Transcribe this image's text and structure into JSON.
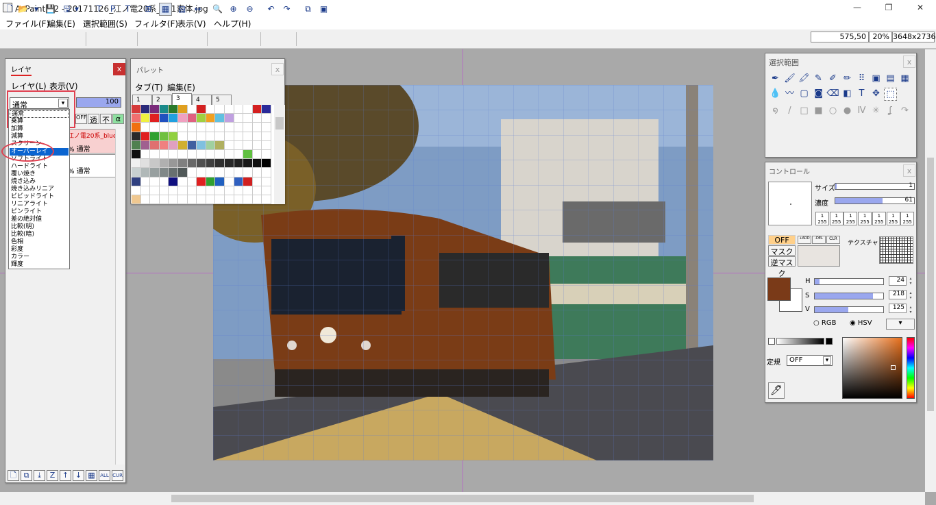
{
  "window": {
    "title": "AzPainter2 - 20171126_江ノ電20系_001素体.jpg",
    "minimize": "—",
    "maximize": "❐",
    "close": "✕"
  },
  "menu": [
    "ファイル(F)",
    "編集(E)",
    "選択範囲(S)",
    "フィルタ(F)",
    "表示(V)",
    "ヘルプ(H)"
  ],
  "status": {
    "coords": "575,50",
    "zoom": "20%",
    "size": "3648x2736"
  },
  "toolbar": {
    "icons": [
      "new-icon",
      "open-icon",
      "open-dropdown-icon",
      "save-icon",
      "save-as-icon",
      "save-dropdown-icon",
      "layer-panel-icon",
      "palette-panel-icon",
      "text-panel-icon",
      "grid-icon",
      "checker-icon",
      "grid2-icon",
      "fit-icon",
      "zoom-icon",
      "zoom-in-icon",
      "zoom-out-icon",
      "undo-icon",
      "redo-icon",
      "filter-icon",
      "select-icon"
    ],
    "glyphs": [
      "🗋",
      "📂",
      "▾",
      "💾",
      "🖫",
      "▾",
      "T",
      "P",
      "T",
      "⊞",
      "▦",
      "▤",
      "↔",
      "🔍",
      "⊕",
      "⊖",
      "↶",
      "↷",
      "⧉",
      "▣"
    ]
  },
  "layer_panel": {
    "title": "レイヤ",
    "close": "x",
    "menu": [
      "レイヤ(L)",
      "表示(V)"
    ],
    "blend_selected": "通常",
    "opacity": "100",
    "blend_options": [
      "通常",
      "乗算",
      "加算",
      "減算",
      "スクリーン",
      "オーバーレイ",
      "ソフトライト",
      "ハードライト",
      "覆い焼き",
      "焼き込み",
      "焼き込みリニア",
      "ビビッドライト",
      "リニアライト",
      "ピンライト",
      "差の絶対値",
      "比較(明)",
      "比較(暗)",
      "色相",
      "彩度",
      "カラー",
      "輝度"
    ],
    "selected_option": "オーバーレイ",
    "flags": [
      "OFF",
      "透",
      "不",
      "α"
    ],
    "layers": [
      {
        "name": "江ノ電20系_blue",
        "mode": "% 通常"
      },
      {
        "name": "",
        "mode": "% 通常"
      }
    ],
    "bottom_buttons": [
      "🗋",
      "⧉",
      "⤓",
      "Z",
      "↑",
      "↓",
      "▦",
      "ALL",
      "CUR"
    ]
  },
  "palette_panel": {
    "title": "パレット",
    "close": "x",
    "menu": [
      "タブ(T)",
      "編集(E)"
    ],
    "tabs": [
      "1",
      "2",
      "3",
      "4",
      "5"
    ],
    "active_tab": "3",
    "rows": [
      [
        "#d63b3b",
        "#2a2a7a",
        "#7a2a7a",
        "#1a8a8a",
        "#2a7a2a",
        "#e0a020",
        "",
        "#d42020",
        "",
        "",
        "",
        "",
        "",
        "#d42020",
        "#2a2a9a"
      ],
      [
        "#f07070",
        "#f0f040",
        "#e02020",
        "#2050c0",
        "#20a0e0",
        "#f0a0c0",
        "#e06080",
        "#a0d040",
        "#f0a020",
        "#60c0e0",
        "#c0a0e0",
        "",
        "",
        "",
        ""
      ],
      [
        "#f07010",
        "",
        "",
        "",
        "",
        "",
        "",
        "",
        "",
        "",
        "",
        "",
        "",
        "",
        ""
      ],
      [
        "#2a2a2a",
        "#e02020",
        "#30a030",
        "#70c040",
        "#90d040",
        "",
        "",
        "",
        "",
        "",
        "",
        "",
        "",
        "",
        ""
      ],
      [
        "#508050",
        "#a06090",
        "#e07070",
        "#f08080",
        "#e0a0c0",
        "#d0b030",
        "#4060a0",
        "#80c0e0",
        "#a0d0a0",
        "#b0b060",
        "",
        "",
        "",
        "",
        ""
      ],
      [
        "#101010",
        "",
        "",
        "",
        "",
        "",
        "",
        "",
        "",
        "",
        "",
        "",
        "#60c040",
        "",
        ""
      ],
      [
        "#f0f0f0",
        "#e0e0e0",
        "#c8c8c8",
        "#b0b0b0",
        "#989898",
        "#808080",
        "#686868",
        "#505050",
        "#404040",
        "#303030",
        "#282828",
        "#202020",
        "#181818",
        "#101010",
        "#000000"
      ],
      [
        "#c8d0d0",
        "#b0b8b8",
        "#98a0a0",
        "#808888",
        "#687070",
        "#505858",
        "",
        "",
        "",
        "",
        "",
        "",
        "",
        "",
        ""
      ],
      [
        "#304080",
        "",
        "",
        "",
        "#101080",
        "",
        "",
        "#e02020",
        "#30a030",
        "#2060c0",
        "",
        "#3060c0",
        "#d02020",
        "",
        ""
      ],
      [
        "",
        "",
        "",
        "",
        "",
        "",
        "",
        "",
        "",
        "",
        "",
        "",
        "",
        "",
        ""
      ],
      [
        "#f0c890",
        "",
        "",
        "",
        "",
        "",
        "",
        "",
        "",
        "",
        "",
        "",
        "",
        "",
        ""
      ]
    ]
  },
  "selection_panel": {
    "title": "選択範囲",
    "close": "x",
    "tools_row1": [
      "pen-icon",
      "brush-icon",
      "marker-icon",
      "airbrush-icon",
      "fude-icon",
      "pencil-icon",
      "dot-pen-icon",
      "stamp-icon",
      "copy-stamp-icon",
      "frame-icon"
    ],
    "glyphs_row1": [
      "✒",
      "🖌",
      "🖍",
      "✎",
      "✐",
      "✏",
      "⠿",
      "▣",
      "▤",
      "▦"
    ],
    "tools_row2": [
      "drop-icon",
      "blur-icon",
      "fill-icon",
      "gradient-fill-icon",
      "eraser-icon",
      "half-icon",
      "text-icon",
      "move-icon",
      "select-rect-icon"
    ],
    "glyphs_row2": [
      "💧",
      "〰",
      "▢",
      "◙",
      "⌫",
      "◧",
      "T",
      "✥",
      "⬚"
    ],
    "tools_row3": [
      "spiral-icon",
      "line-icon",
      "rect-icon",
      "fill-rect-icon",
      "ellipse-icon",
      "fill-ellipse-icon",
      "zigzag-icon",
      "star-icon",
      "curve-icon",
      "arc-icon"
    ],
    "glyphs_row3": [
      "໑",
      "/",
      "□",
      "■",
      "○",
      "●",
      "Ⅳ",
      "✳",
      "ʆ",
      "↷"
    ]
  },
  "control_panel": {
    "title": "コントロール",
    "close": "x",
    "size_label": "サイズ",
    "size_value": "1",
    "density_label": "濃度",
    "density_value": "61",
    "density_fraction": 0.6,
    "size_fraction": 0.02,
    "pressure_buttons": [
      "1/255",
      "1/255",
      "1/255",
      "1/255",
      "1/255",
      "1/255",
      "1/255"
    ],
    "mask_off": "OFF",
    "mask_buttons": [
      "マスク",
      "逆マスク"
    ],
    "mask_small": [
      "+ADD",
      "-DEL",
      "CLR"
    ],
    "texture_label": "テクスチャ",
    "color": "#7a3a18",
    "h_label": "H",
    "h_value": "24",
    "h_fraction": 0.07,
    "s_label": "S",
    "s_value": "218",
    "s_fraction": 0.85,
    "v_label": "V",
    "v_value": "125",
    "v_fraction": 0.49,
    "rgb_label": "RGB",
    "hsv_label": "HSV",
    "mode_label": "定規",
    "mode_value": "OFF",
    "dropdown": "▾"
  }
}
